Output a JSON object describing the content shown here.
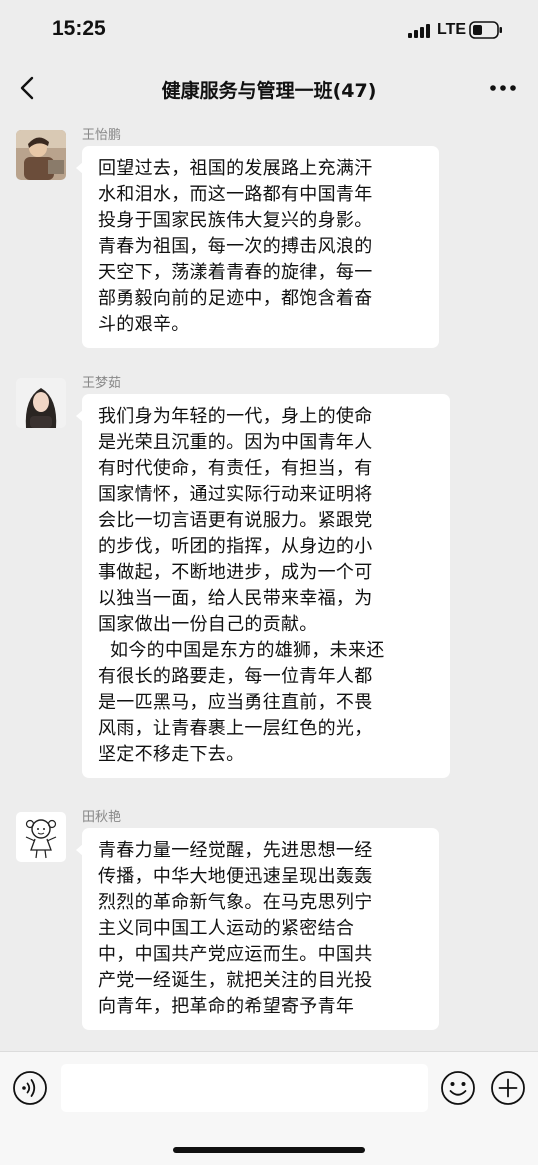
{
  "status_bar": {
    "time": "15:25",
    "network": "LTE"
  },
  "header": {
    "title": "健康服务与管理一班(47)"
  },
  "messages": [
    {
      "sender": "王怡鹏",
      "avatar": "photo-avatar-icon",
      "text": "回望过去，祖国的发展路上充满汗\n水和泪水，而这一路都有中国青年\n投身于国家民族伟大复兴的身影。\n青春为祖国，每一次的搏击风浪的\n天空下，荡漾着青春的旋律，每一\n部勇毅向前的足迹中，都饱含着奋\n斗的艰辛。"
    },
    {
      "sender": "王梦茹",
      "avatar": "portrait-avatar-icon",
      "text": "我们身为年轻的一代，身上的使命\n是光荣且沉重的。因为中国青年人\n有时代使命，有责任，有担当，有\n国家情怀，通过实际行动来证明将\n会比一切言语更有说服力。紧跟党\n的步伐，听团的指挥，从身边的小\n事做起，不断地进步，成为一个可\n以独当一面，给人民带来幸福，为\n国家做出一份自己的贡献。\n  如今的中国是东方的雄狮，未来还\n有很长的路要走，每一位青年人都\n是一匹黑马，应当勇往直前，不畏\n风雨，让青春裹上一层红色的光，\n坚定不移走下去。"
    },
    {
      "sender": "田秋艳",
      "avatar": "cartoon-girl-avatar-icon",
      "text": "青春力量一经觉醒，先进思想一经\n传播，中华大地便迅速呈现出轰轰\n烈烈的革命新气象。在马克思列宁\n主义同中国工人运动的紧密结合\n中，中国共产党应运而生。中国共\n产党一经诞生，就把关注的目光投\n向青年，把革命的希望寄予青年"
    }
  ],
  "input_bar": {
    "voice": "voice-icon",
    "emoji": "emoji-icon",
    "plus": "plus-icon",
    "placeholder": ""
  },
  "colors": {
    "background": "#ededed",
    "bubble": "#ffffff",
    "sender": "#888888",
    "text": "#111111"
  }
}
